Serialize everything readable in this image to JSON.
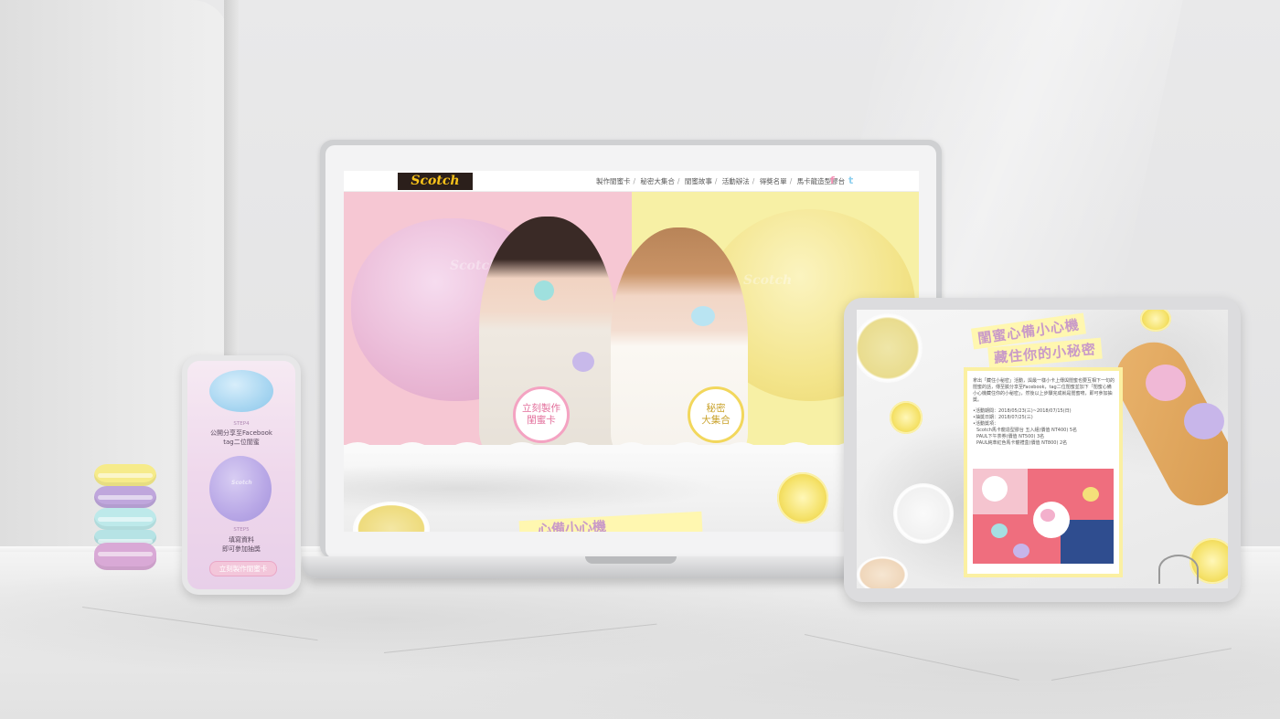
{
  "laptop": {
    "logo": "Scotch",
    "nav": [
      "製作閨蜜卡",
      "秘密大集合",
      "閨蜜故事",
      "活動辦法",
      "得獎名單",
      "馬卡龍造型膠台"
    ],
    "nav_separator": "/",
    "social": [
      "f",
      "t"
    ],
    "cta_make_card": "立刻製作\n閨蜜卡",
    "cta_secrets": "秘密\n大集合",
    "bottom_banner": "心備小心機",
    "mac_brand": "Scotch",
    "colors": {
      "accent_pink": "#f4a3c2",
      "accent_yellow": "#f2d75c"
    }
  },
  "phone": {
    "step4_label": "STEP4",
    "step4_text": "公開分享至Facebook\ntag二位閨蜜",
    "step5_label": "STEP5",
    "step5_text": "填寫資料\n即可參加抽獎",
    "cta": "立刻製作閨蜜卡",
    "mac_brand": "Scotch"
  },
  "tablet": {
    "title_line1": "閨蜜心備小心機",
    "title_line2": "藏住你的小秘密",
    "intro": "拿出「藏住小秘密」活動，與最一樣小卡上傳與閨蜜也要互相下一句的閨蜜的話，傳至臉分享至Facebook，tag二位閨蜜並加下「閨蜜心備小心機藏住你的小秘密」，然後以上步驟完成就是閨蜜唷，即可參加抽獎。",
    "period_label": "•活動期間：2018/05/23(三)~2018/07/15(日)",
    "announce_label": "•抽獎日期：2018/07/25(三)",
    "prize_title": "•活動獎項：",
    "prizes": [
      "Scotch馬卡龍造型膠台 五入組(價值 NT400) 5名",
      "PAUL下午茶券(價值 NT500) 3名",
      "PAUL純萃紅色馬卡龍禮盒(價值 NT800) 2名"
    ]
  }
}
